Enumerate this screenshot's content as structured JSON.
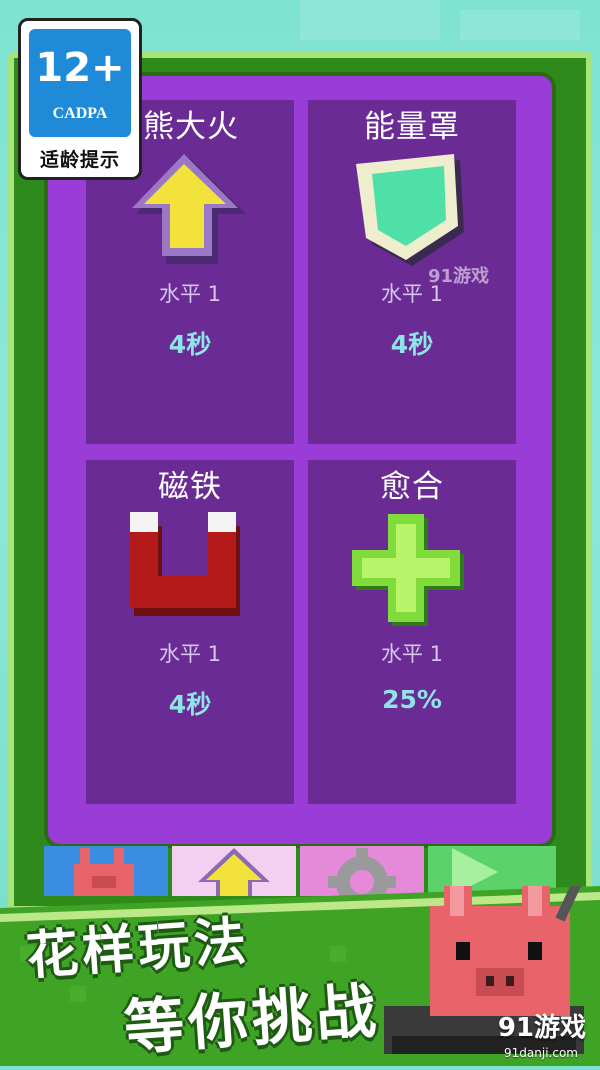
{
  "cadpa": {
    "age": "12+",
    "org": "CADPA",
    "hint": "适龄提示"
  },
  "powerups": [
    {
      "title": "熊熊大火",
      "icon": "up-arrow-icon",
      "level": "水平 1",
      "value": "4秒"
    },
    {
      "title": "能量罩",
      "icon": "shield-icon",
      "level": "水平 1",
      "value": "4秒"
    },
    {
      "title": "磁铁",
      "icon": "magnet-icon",
      "level": "水平 1",
      "value": "4秒"
    },
    {
      "title": "愈合",
      "icon": "heal-cross-icon",
      "level": "水平 1",
      "value": "25%"
    }
  ],
  "tabs": [
    {
      "name": "tank-tab",
      "icon": "pig-tank-icon",
      "color": "#3a8de0"
    },
    {
      "name": "powerup-tab",
      "icon": "up-arrow-icon",
      "color": "#f3d0f2"
    },
    {
      "name": "settings-tab",
      "icon": "gear-icon",
      "color": "#e58ad8"
    },
    {
      "name": "play-tab",
      "icon": "play-icon",
      "color": "#5bd26a"
    }
  ],
  "watermark": "91游戏",
  "promo": {
    "line1": "花样玩法",
    "line2": "等你挑战"
  },
  "brand": {
    "name": "91游戏",
    "url": "91danji.com"
  },
  "colors": {
    "panel": "#9a3cd7",
    "card": "#6a2b95",
    "frame": "#2f8a1c",
    "value": "#8ee4e6"
  }
}
